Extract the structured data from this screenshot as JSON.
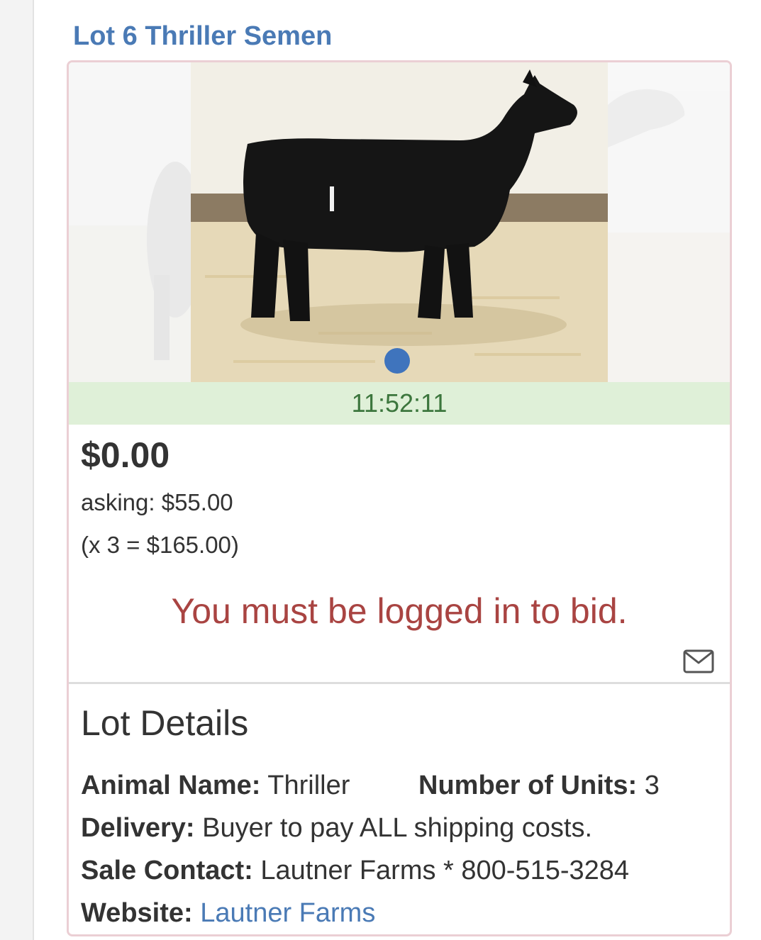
{
  "lot": {
    "title": "Lot 6 Thriller Semen"
  },
  "carousel": {
    "current_index": 1,
    "total_slides": 1
  },
  "timer": "11:52:11",
  "pricing": {
    "current_bid": "$0.00",
    "asking": "asking: $55.00",
    "multiplier": "(x 3 = $165.00)"
  },
  "login_message": "You must be logged in to bid.",
  "details": {
    "heading": "Lot Details",
    "animal_name_label": "Animal Name:",
    "animal_name_value": "Thriller",
    "units_label": "Number of Units:",
    "units_value": "3",
    "delivery_label": "Delivery:",
    "delivery_value": "Buyer to pay ALL shipping costs.",
    "contact_label": "Sale Contact:",
    "contact_value": "Lautner Farms * 800-515-3284",
    "website_label": "Website:",
    "website_value": "Lautner Farms"
  },
  "colors": {
    "title_link": "#4a7ab5",
    "card_border": "#ebcfd4",
    "timer_bg": "#dff0d8",
    "timer_text": "#3c763d",
    "login_text": "#a94442",
    "dot": "#3f74bd"
  },
  "icons": {
    "envelope": "envelope-icon",
    "carousel_dot": "carousel-dot"
  }
}
